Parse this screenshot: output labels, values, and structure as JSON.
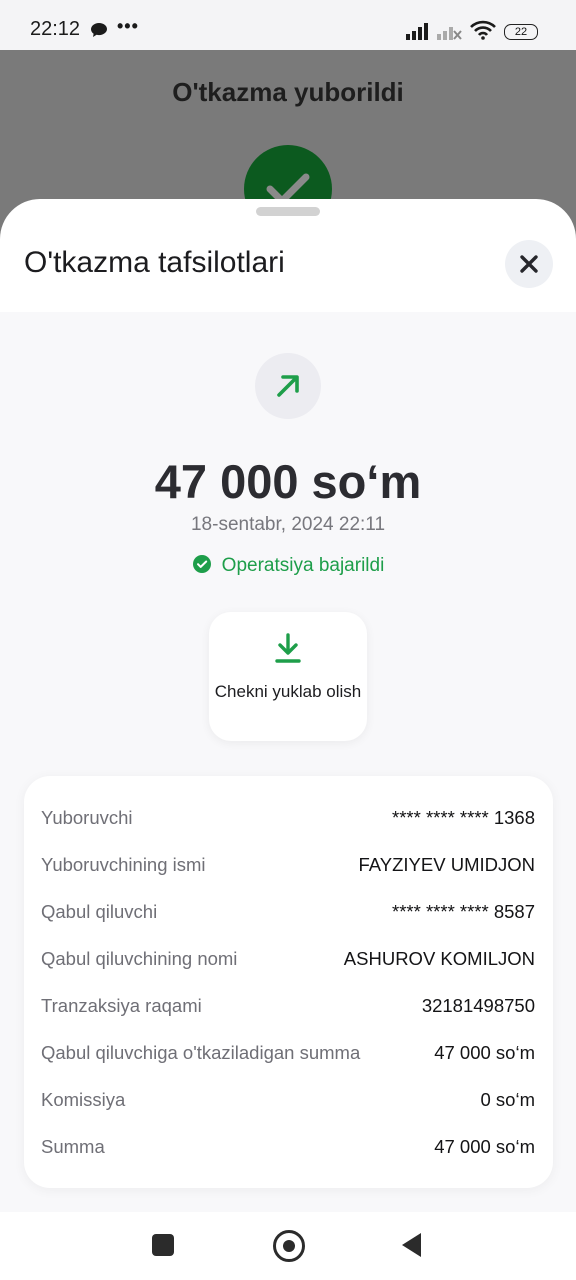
{
  "status_bar": {
    "time": "22:12",
    "more": "•••",
    "battery": "22"
  },
  "backdrop": {
    "title": "O'tkazma yuborildi"
  },
  "sheet": {
    "title": "O'tkazma tafsilotlari",
    "amount": "47 000 so‘m",
    "datetime": "18-sentabr, 2024 22:11",
    "status": "Operatsiya bajarildi",
    "receipt_button_label": "Chekni yuklab olish",
    "colors": {
      "accent_green": "#1e9e4a",
      "text_dark": "#2c2c31"
    }
  },
  "details": {
    "rows": [
      {
        "label": "Yuboruvchi",
        "value": "**** **** **** 1368"
      },
      {
        "label": "Yuboruvchining ismi",
        "value": "FAYZIYEV UMIDJON"
      },
      {
        "label": "Qabul qiluvchi",
        "value": "**** **** **** 8587"
      },
      {
        "label": "Qabul qiluvchining nomi",
        "value": "ASHUROV KOMILJON"
      },
      {
        "label": "Tranzaksiya raqami",
        "value": "32181498750"
      },
      {
        "label": "Qabul qiluvchiga o'tkaziladigan summa",
        "value": "47 000 so‘m"
      },
      {
        "label": "Komissiya",
        "value": "0 so‘m"
      },
      {
        "label": "Summa",
        "value": "47 000 so‘m"
      }
    ]
  },
  "icons": {
    "chat": "chat-bubble-icon",
    "signal": "signal-icon",
    "wifi": "wifi-icon",
    "close": "close-icon",
    "arrow": "arrow-up-right-icon",
    "check": "check-circle-icon",
    "download": "download-icon"
  }
}
